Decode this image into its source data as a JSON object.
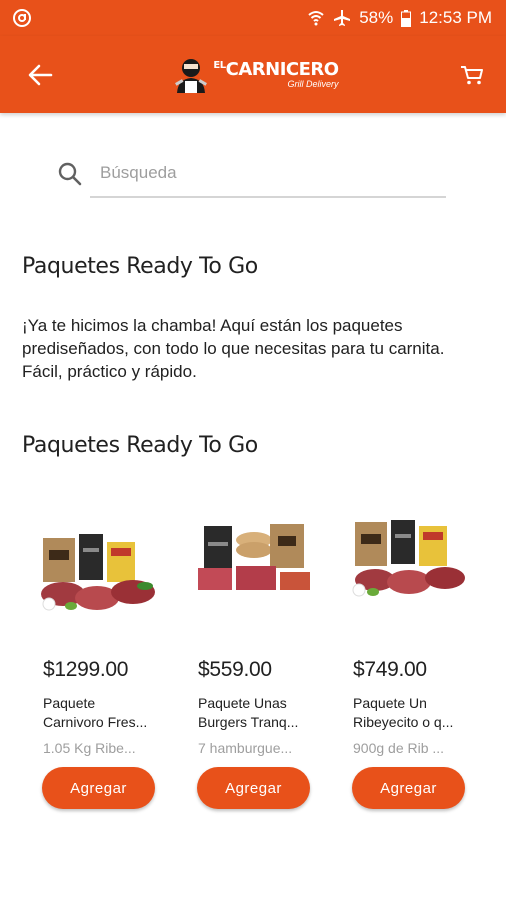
{
  "status_bar": {
    "battery": "58%",
    "time": "12:53 PM"
  },
  "header": {
    "logo_prefix": "EL",
    "logo_main": "CARNICERO",
    "logo_sub": "Grill Delivery"
  },
  "search": {
    "placeholder": "Búsqueda",
    "value": ""
  },
  "intro": {
    "title": "Paquetes Ready To Go",
    "description": "¡Ya te hicimos la chamba! Aquí están los paquetes prediseñados, con todo lo que necesitas para tu carnita. Fácil, práctico y rápido."
  },
  "section": {
    "title": "Paquetes Ready To Go"
  },
  "products": [
    {
      "price": "$1299.00",
      "name_line1": "Paquete",
      "name_line2": "Carnivoro Fres...",
      "desc": "1.05 Kg Ribe...",
      "button": "Agregar"
    },
    {
      "price": "$559.00",
      "name_line1": "Paquete Unas",
      "name_line2": "Burgers Tranq...",
      "desc": "7 hamburgue...",
      "button": "Agregar"
    },
    {
      "price": "$749.00",
      "name_line1": "Paquete Un",
      "name_line2": "Ribeyecito o q...",
      "desc": "900g de Rib ...",
      "button": "Agregar"
    }
  ],
  "colors": {
    "brand": "#e8511a",
    "text": "#212121",
    "muted": "#9e9e9e"
  },
  "icons": [
    "notification-icon",
    "wifi-icon",
    "airplane-icon",
    "battery-icon",
    "back-arrow-icon",
    "cart-icon",
    "search-icon"
  ]
}
